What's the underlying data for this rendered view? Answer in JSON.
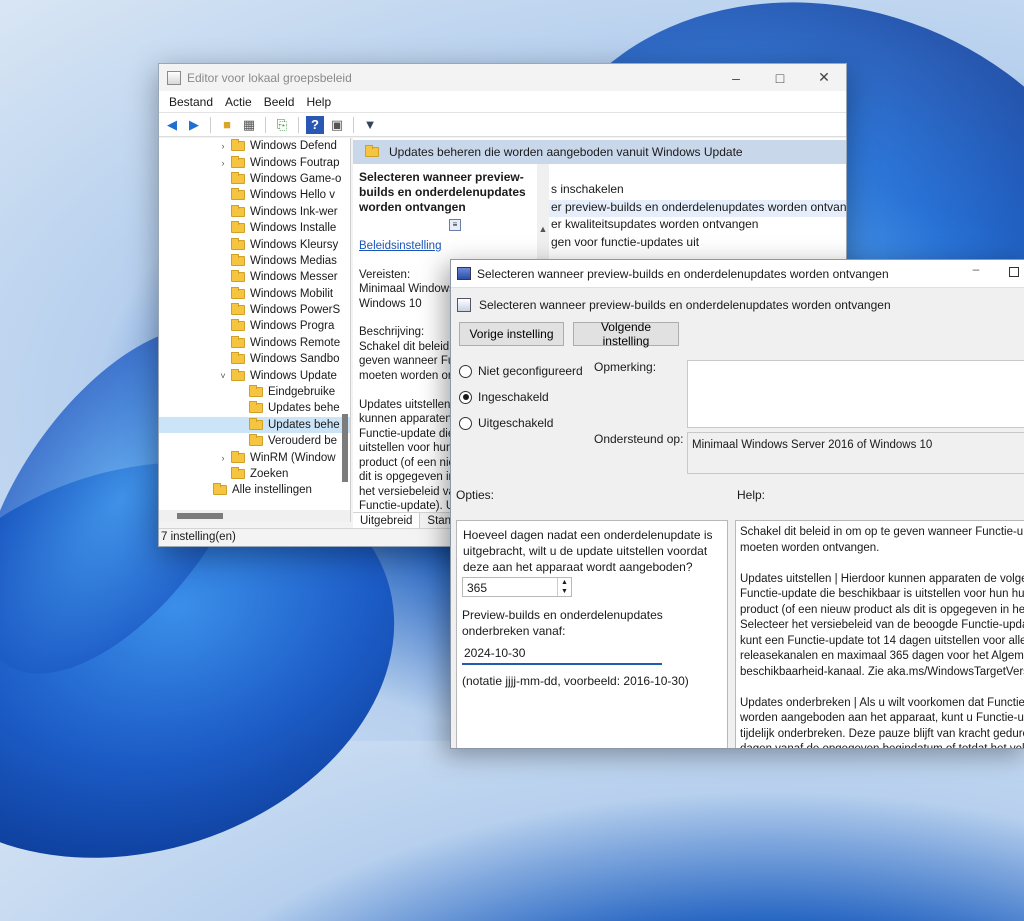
{
  "main_window": {
    "title": "Editor voor lokaal groepsbeleid",
    "menu": [
      "Bestand",
      "Actie",
      "Beeld",
      "Help"
    ],
    "tree": [
      {
        "label": "Windows Defend",
        "indent": 1,
        "chevron": true
      },
      {
        "label": "Windows Foutrap",
        "indent": 1,
        "chevron": true
      },
      {
        "label": "Windows Game-o",
        "indent": 1,
        "chevron": false
      },
      {
        "label": "Windows Hello v",
        "indent": 1,
        "chevron": false
      },
      {
        "label": "Windows Ink-wer",
        "indent": 1,
        "chevron": false
      },
      {
        "label": "Windows Installe",
        "indent": 1,
        "chevron": false
      },
      {
        "label": "Windows Kleursy",
        "indent": 1,
        "chevron": false
      },
      {
        "label": "Windows Medias",
        "indent": 1,
        "chevron": false
      },
      {
        "label": "Windows Messer",
        "indent": 1,
        "chevron": false
      },
      {
        "label": "Windows Mobilit",
        "indent": 1,
        "chevron": false
      },
      {
        "label": "Windows PowerS",
        "indent": 1,
        "chevron": false
      },
      {
        "label": "Windows Progra",
        "indent": 1,
        "chevron": false
      },
      {
        "label": "Windows Remote",
        "indent": 1,
        "chevron": false
      },
      {
        "label": "Windows Sandbo",
        "indent": 1,
        "chevron": false
      },
      {
        "label": "Windows Update",
        "indent": 1,
        "chevron": true,
        "expanded": true
      },
      {
        "label": "Eindgebruike",
        "indent": 2,
        "chevron": false
      },
      {
        "label": "Updates behe",
        "indent": 2,
        "chevron": false
      },
      {
        "label": "Updates behe",
        "indent": 2,
        "chevron": false,
        "selected": true
      },
      {
        "label": "Verouderd be",
        "indent": 2,
        "chevron": false
      },
      {
        "label": "WinRM (Window",
        "indent": 1,
        "chevron": true
      },
      {
        "label": "Zoeken",
        "indent": 1,
        "chevron": false
      },
      {
        "label": "Alle instellingen",
        "indent": 0,
        "chevron": false
      }
    ],
    "pane_header": "Updates beheren die worden aangeboden vanuit Windows Update",
    "desc": {
      "title": "Selecteren wanneer preview-builds en onderdelenupdates worden ontvangen",
      "link": "Beleidsinstelling",
      "req_label": "Vereisten:",
      "req_text": "Minimaal Windows",
      "req_text2": "Windows 10",
      "desc_label": "Beschrijving:",
      "body": "Schakel dit beleid in\ngeven wanneer Fun\nmoeten worden on\n\nUpdates uitstellen |\nkunnen apparaten d\nFunctie-update die\nuitstellen voor hun\nproduct (of een nie\ndit is opgegeven in\nhet versiebeleid va\nFunctie-update). U\nFunctie-update tot\nuitstellen voor alle"
    },
    "settings_list": [
      "s inschakelen",
      "er preview-builds en onderdelenupdates worden ontvangen",
      "er kwaliteitsupdates worden ontvangen",
      "gen voor functie-updates uit"
    ],
    "tabs": [
      "Uitgebreid",
      "Stand"
    ],
    "status": "7 instelling(en)"
  },
  "dialog": {
    "title": "Selecteren wanneer preview-builds en onderdelenupdates worden ontvangen",
    "subtitle": "Selecteren wanneer preview-builds en onderdelenupdates worden ontvangen",
    "prev_button": "Vorige instelling",
    "next_button": "Volgende instelling",
    "radio_not_configured": "Niet geconfigureerd",
    "radio_enabled": "Ingeschakeld",
    "radio_disabled": "Uitgeschakeld",
    "selected_state": "Ingeschakeld",
    "comment_label": "Opmerking:",
    "supported_label": "Ondersteund op:",
    "supported_value": "Minimaal Windows Server 2016 of Windows 10",
    "options_label": "Opties:",
    "help_label": "Help:",
    "options": {
      "days_question": "Hoeveel dagen nadat een onderdelenupdate is uitgebracht, wilt u de update uitstellen voordat deze aan het apparaat wordt aangeboden?",
      "days_value": "365",
      "pause_label": "Preview-builds en onderdelenupdates onderbreken vanaf:",
      "pause_date": "2024-10-30",
      "date_hint": "(notatie jjjj-mm-dd, voorbeeld: 2016-10-30)"
    },
    "help_text": "Schakel dit beleid in om op te geven wanneer Functie-upda\nmoeten worden ontvangen.\n\nUpdates uitstellen | Hierdoor kunnen apparaten de volgend\nFunctie-update die beschikbaar is uitstellen voor hun huidig\nproduct (of een nieuw product als dit is opgegeven in het\nSelecteer het versiebeleid van de beoogde Functie-update).\nkunt een Functie-update tot 14 dagen uitstellen voor alle pr\nreleasekanalen en maximaal 365 dagen voor het Algemene\nbeschikbaarheid-kanaal. Zie aka.ms/WindowsTargetVersionin\n\nUpdates onderbreken | Als u wilt voorkomen dat Functie-up\nworden aangeboden aan het apparaat, kunt u Functie-upda\ntijdelijk onderbreken. Deze pauze blijft van kracht gedurend\ndagen vanaf de opgegeven begindatum of totdat het veld i"
  }
}
